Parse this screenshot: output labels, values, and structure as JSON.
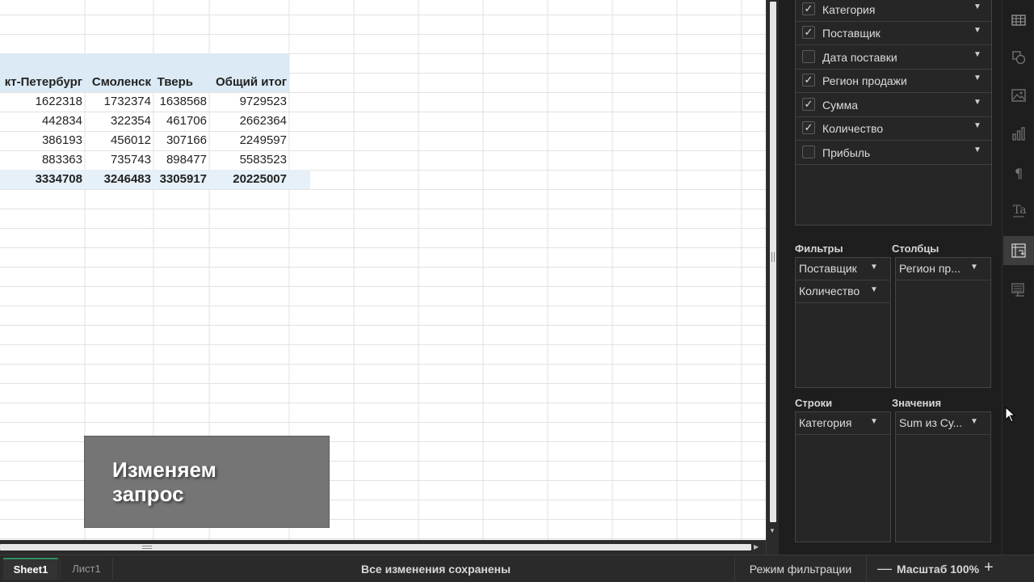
{
  "pivot": {
    "headers": [
      "кт-Петербург",
      "Смоленск",
      "Тверь",
      "Общий итог"
    ],
    "rows": [
      [
        "1622318",
        "1732374",
        "1638568",
        "9729523"
      ],
      [
        "442834",
        "322354",
        "461706",
        "2662364"
      ],
      [
        "386193",
        "456012",
        "307166",
        "2249597"
      ],
      [
        "883363",
        "735743",
        "898477",
        "5583523"
      ]
    ],
    "totals": [
      "3334708",
      "3246483",
      "3305917",
      "20225007"
    ]
  },
  "caption": {
    "text": "Изменяем\nзапрос"
  },
  "field_list": [
    {
      "label": "Категория",
      "checked": true,
      "check_glyph": "✓"
    },
    {
      "label": "Поставщик",
      "checked": true,
      "check_glyph": "✓"
    },
    {
      "label": "Дата поставки",
      "checked": false,
      "check_glyph": ""
    },
    {
      "label": "Регион продажи",
      "checked": true,
      "check_glyph": "✓"
    },
    {
      "label": "Сумма",
      "checked": true,
      "check_glyph": "✓"
    },
    {
      "label": "Количество",
      "checked": true,
      "check_glyph": "✓"
    },
    {
      "label": "Прибыль",
      "checked": false,
      "check_glyph": ""
    }
  ],
  "zones": {
    "filters": {
      "title": "Фильтры",
      "items": [
        "Поставщик",
        "Количество"
      ]
    },
    "columns": {
      "title": "Столбцы",
      "items": [
        "Регион пр..."
      ]
    },
    "rows": {
      "title": "Строки",
      "items": [
        "Категория"
      ]
    },
    "values": {
      "title": "Значения",
      "items": [
        "Sum из Су..."
      ]
    }
  },
  "toolbar_icons": [
    "table-icon",
    "shape-icon",
    "image-icon",
    "chart-icon",
    "paragraph-icon",
    "text-art-icon",
    "pivot-table-icon",
    "slicer-icon"
  ],
  "status": {
    "tabs": [
      "Sheet1",
      "Лист1"
    ],
    "active_tab": "Sheet1",
    "saved_text": "Все изменения сохранены",
    "filter_mode": "Режим фильтрации",
    "zoom_minus": "—",
    "zoom_label": "Масштаб 100%",
    "zoom_plus": "+"
  },
  "colors": {
    "accent_tab": "#2f8a5d",
    "pivot_header": "#dbeaf5",
    "panel_bg": "#1e1e1e"
  }
}
